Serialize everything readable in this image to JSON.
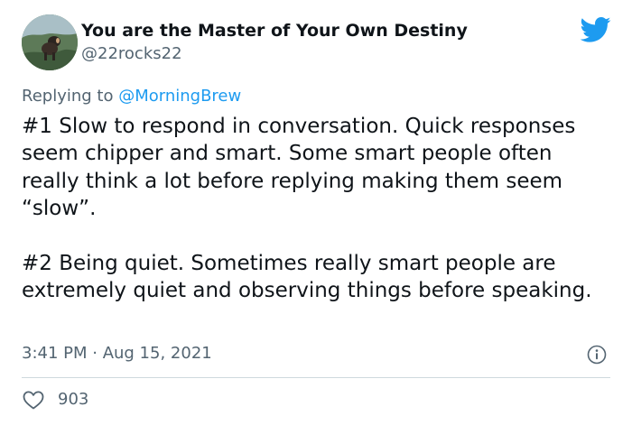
{
  "author": {
    "display_name": "You are the Master of Your Own Destiny",
    "handle": "@22rocks22"
  },
  "reply": {
    "prefix": "Replying to ",
    "mention": "@MorningBrew"
  },
  "tweet": {
    "paragraphs": [
      "#1 Slow to respond in conversation.   Quick responses seem chipper and smart.  Some smart people often really think a lot before replying making them seem “slow”.",
      "#2 Being quiet.  Sometimes really smart people are extremely quiet and observing things before speaking."
    ]
  },
  "meta": {
    "timestamp": "3:41 PM · Aug 15, 2021"
  },
  "engagement": {
    "likes": "903"
  },
  "icons": {
    "brand": "twitter-bird-icon",
    "info": "info-icon",
    "like": "heart-icon"
  },
  "colors": {
    "accent": "#1d9bf0",
    "text": "#0f1419",
    "secondary": "#536471",
    "divider": "#cfd9de"
  }
}
